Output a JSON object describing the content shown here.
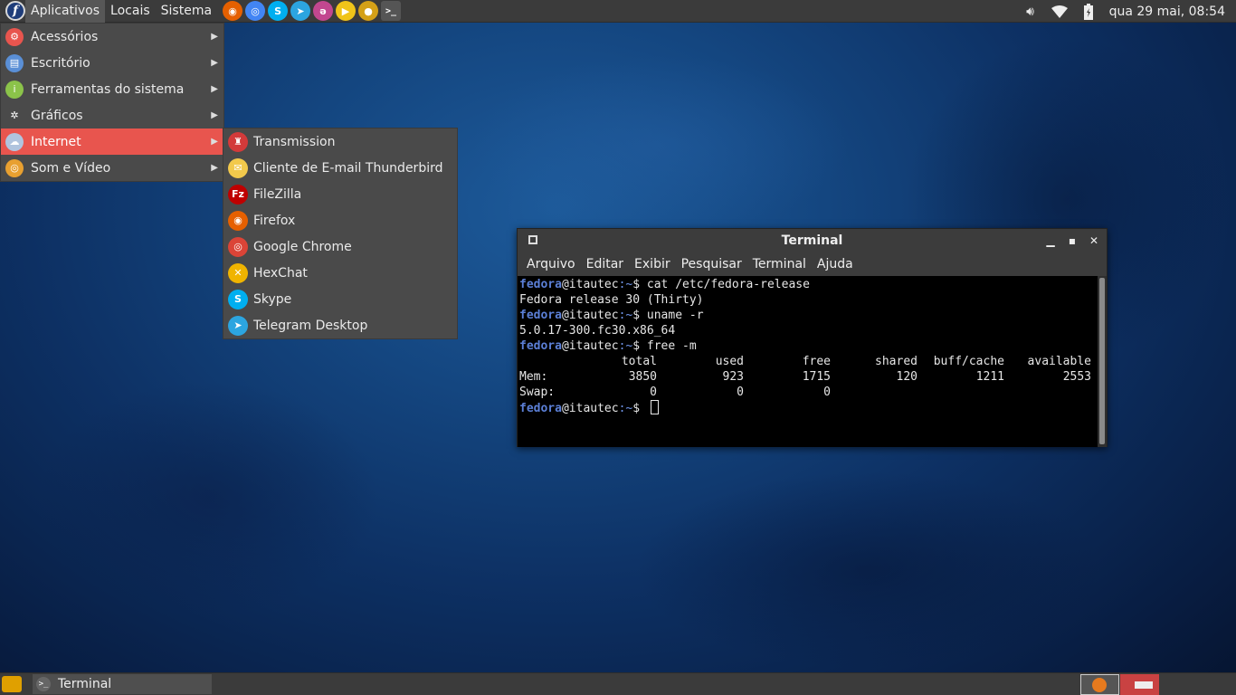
{
  "top_panel": {
    "menus": [
      "Aplicativos",
      "Locais",
      "Sistema"
    ],
    "launchers": [
      {
        "icon": "firefox-icon",
        "color": "#e66000",
        "glyph": "◉"
      },
      {
        "icon": "chrome-icon",
        "color": "#4285f4",
        "glyph": "◎"
      },
      {
        "icon": "skype-icon",
        "color": "#00aff0",
        "glyph": "S"
      },
      {
        "icon": "telegram-icon",
        "color": "#2ca5e0",
        "glyph": "➤"
      },
      {
        "icon": "anydesk-icon",
        "color": "#c2478f",
        "glyph": "ə"
      },
      {
        "icon": "media-player-icon",
        "color": "#f0c419",
        "glyph": "▶"
      },
      {
        "icon": "record-icon",
        "color": "#d4a017",
        "glyph": "●"
      },
      {
        "icon": "terminal-icon",
        "color": "#555555",
        "glyph": ">_"
      }
    ],
    "clock": "qua 29 mai, 08:54",
    "tray_icons": [
      "volume-icon",
      "wifi-icon",
      "battery-icon"
    ]
  },
  "app_menu": {
    "items": [
      {
        "label": "Acessórios",
        "icon": "accessories-icon",
        "color": "#e8554e",
        "glyph": "⚙"
      },
      {
        "label": "Escritório",
        "icon": "office-icon",
        "color": "#5a8fd6",
        "glyph": "▤"
      },
      {
        "label": "Ferramentas do sistema",
        "icon": "system-tools-icon",
        "color": "#8bc34a",
        "glyph": "i"
      },
      {
        "label": "Gráficos",
        "icon": "graphics-icon",
        "color": "#4a4a4a",
        "glyph": "✲"
      },
      {
        "label": "Internet",
        "icon": "internet-icon",
        "color": "#b0c4de",
        "glyph": "☁"
      },
      {
        "label": "Som e Vídeo",
        "icon": "sound-video-icon",
        "color": "#e8a030",
        "glyph": "◎"
      }
    ],
    "active_index": 4
  },
  "internet_submenu": {
    "items": [
      {
        "label": "Transmission",
        "icon": "transmission-icon",
        "color": "#d33a3a",
        "glyph": "♜"
      },
      {
        "label": "Cliente de E-mail Thunderbird",
        "icon": "thunderbird-icon",
        "color": "#f2c94c",
        "glyph": "✉"
      },
      {
        "label": "FileZilla",
        "icon": "filezilla-icon",
        "color": "#bf0000",
        "glyph": "Fz"
      },
      {
        "label": "Firefox",
        "icon": "firefox-icon",
        "color": "#e66000",
        "glyph": "◉"
      },
      {
        "label": "Google Chrome",
        "icon": "chrome-icon",
        "color": "#db4437",
        "glyph": "◎"
      },
      {
        "label": "HexChat",
        "icon": "hexchat-icon",
        "color": "#f0b400",
        "glyph": "✕"
      },
      {
        "label": "Skype",
        "icon": "skype-icon",
        "color": "#00aff0",
        "glyph": "S"
      },
      {
        "label": "Telegram Desktop",
        "icon": "telegram-icon",
        "color": "#2ca5e0",
        "glyph": "➤"
      }
    ]
  },
  "terminal": {
    "title": "Terminal",
    "menubar": [
      "Arquivo",
      "Editar",
      "Exibir",
      "Pesquisar",
      "Terminal",
      "Ajuda"
    ],
    "prompt": {
      "user": "fedora",
      "host": "@itautec",
      "path": ":~",
      "symbol": "$"
    },
    "session": [
      {
        "type": "cmd",
        "text": "cat /etc/fedora-release"
      },
      {
        "type": "out",
        "text": "Fedora release 30 (Thirty)"
      },
      {
        "type": "cmd",
        "text": "uname -r"
      },
      {
        "type": "out",
        "text": "5.0.17-300.fc30.x86_64"
      },
      {
        "type": "cmd",
        "text": "free -m"
      }
    ],
    "free_table": {
      "headers": [
        "",
        "total",
        "used",
        "free",
        "shared",
        "buff/cache",
        "available"
      ],
      "rows": [
        [
          "Mem:",
          "3850",
          "923",
          "1715",
          "120",
          "1211",
          "2553"
        ],
        [
          "Swap:",
          "0",
          "0",
          "0",
          "",
          "",
          ""
        ]
      ]
    }
  },
  "bottom_panel": {
    "task_label": "Terminal",
    "workspaces": 2
  }
}
